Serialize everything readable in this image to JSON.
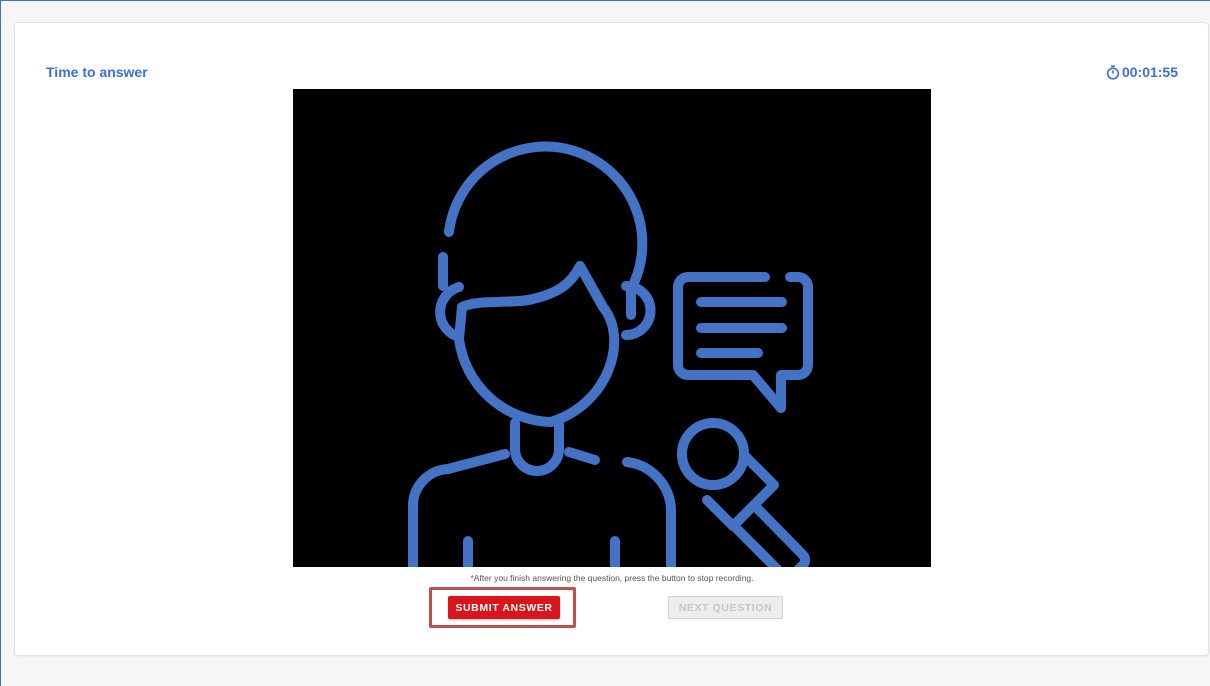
{
  "header": {
    "time_label": "Time to answer",
    "timer_icon": "stopwatch-icon",
    "timer_value": "00:01:55"
  },
  "video": {
    "illustration_icon": "interviewee-headset-microphone-icon"
  },
  "hint": {
    "text": "*After you finish answering the question, press the button to stop recording."
  },
  "actions": {
    "submit_label": "SUBMIT ANSWER",
    "next_label": "NEXT QUESTION"
  },
  "colors": {
    "accent_blue": "#3d6fd6",
    "submit_red": "#d9151b",
    "highlight_outline": "#c0504d"
  }
}
